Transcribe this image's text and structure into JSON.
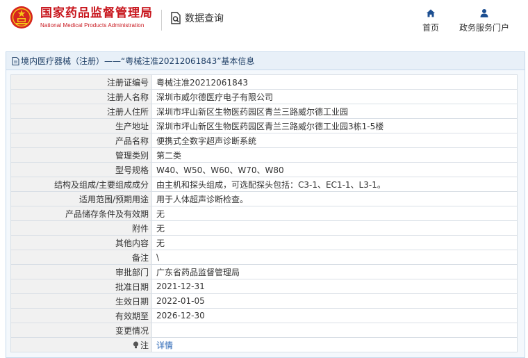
{
  "header": {
    "logo_cn": "国家药品监督管理局",
    "logo_en": "National Medical Products Administration",
    "query_label": "数据查询",
    "nav": [
      {
        "label": "首页",
        "icon": "home-icon"
      },
      {
        "label": "政务服务门户",
        "icon": "user-icon"
      }
    ]
  },
  "panel": {
    "title": "境内医疗器械（注册）——“粤械注准20212061843”基本信息"
  },
  "rows": [
    {
      "label": "注册证编号",
      "value": "粤械注准20212061843"
    },
    {
      "label": "注册人名称",
      "value": "深圳市威尔德医疗电子有限公司"
    },
    {
      "label": "注册人住所",
      "value": "深圳市坪山新区生物医药园区青兰三路威尔德工业园"
    },
    {
      "label": "生产地址",
      "value": "深圳市坪山新区生物医药园区青兰三路威尔德工业园3栋1-5楼"
    },
    {
      "label": "产品名称",
      "value": "便携式全数字超声诊断系统"
    },
    {
      "label": "管理类别",
      "value": "第二类"
    },
    {
      "label": "型号规格",
      "value": "W40、W50、W60、W70、W80"
    },
    {
      "label": "结构及组成/主要组成成分",
      "value": "由主机和探头组成，可选配探头包括：C3-1、EC1-1、L3-1。"
    },
    {
      "label": "适用范围/预期用途",
      "value": "用于人体超声诊断检查。"
    },
    {
      "label": "产品储存条件及有效期",
      "value": "无"
    },
    {
      "label": "附件",
      "value": "无"
    },
    {
      "label": "其他内容",
      "value": "无"
    },
    {
      "label": "备注",
      "value": "\\"
    },
    {
      "label": "审批部门",
      "value": "广东省药品监督管理局"
    },
    {
      "label": "批准日期",
      "value": "2021-12-31"
    },
    {
      "label": "生效日期",
      "value": "2022-01-05"
    },
    {
      "label": "有效期至",
      "value": "2026-12-30"
    },
    {
      "label": "变更情况",
      "value": ""
    }
  ],
  "note_row": {
    "label": "注",
    "link": "详情"
  },
  "colors": {
    "brand_red": "#c8161d",
    "link_blue": "#2a66b5",
    "panel_border": "#c6d9ec"
  }
}
